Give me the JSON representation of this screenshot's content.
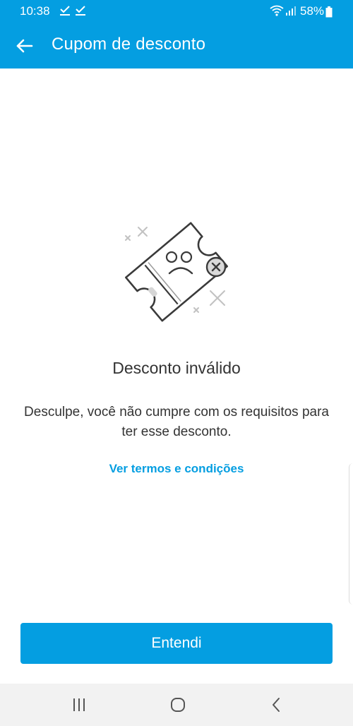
{
  "status_bar": {
    "time": "10:38",
    "download_glyph": "✓",
    "battery": "58%"
  },
  "app_bar": {
    "title": "Cupom de desconto",
    "back_icon": "arrow-left-icon"
  },
  "content": {
    "illustration": "invalid-coupon-illustration",
    "heading": "Desconto inválido",
    "message": "Desculpe, você não cumpre com os requisitos para ter esse desconto.",
    "terms_link": "Ver termos e condições"
  },
  "actions": {
    "confirm_label": "Entendi"
  },
  "nav_bar": {
    "icons": [
      "recents-icon",
      "home-icon",
      "back-icon"
    ]
  },
  "colors": {
    "accent": "#049ee1",
    "text": "#333333",
    "nav_background": "#f2f2f2"
  }
}
